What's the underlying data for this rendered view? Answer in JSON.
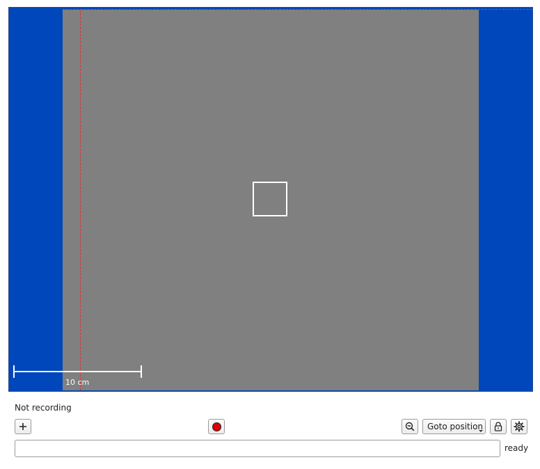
{
  "viewport": {
    "scale_label": "10 cm",
    "colors": {
      "background": "#0047bb",
      "stage": "#808080",
      "guide_lines": "#e03030",
      "target": "#ffffff"
    }
  },
  "status": {
    "recording_text": "Not recording"
  },
  "toolbar": {
    "add_icon": "plus-icon",
    "record_icon": "record-icon",
    "zoom_icon": "zoom-out-icon",
    "goto_select_value": "Goto position",
    "lock_icon": "unlock-icon",
    "settings_icon": "gear-icon",
    "record_color": "#dd0000"
  },
  "command": {
    "value": "",
    "placeholder": "",
    "state": "ready"
  }
}
